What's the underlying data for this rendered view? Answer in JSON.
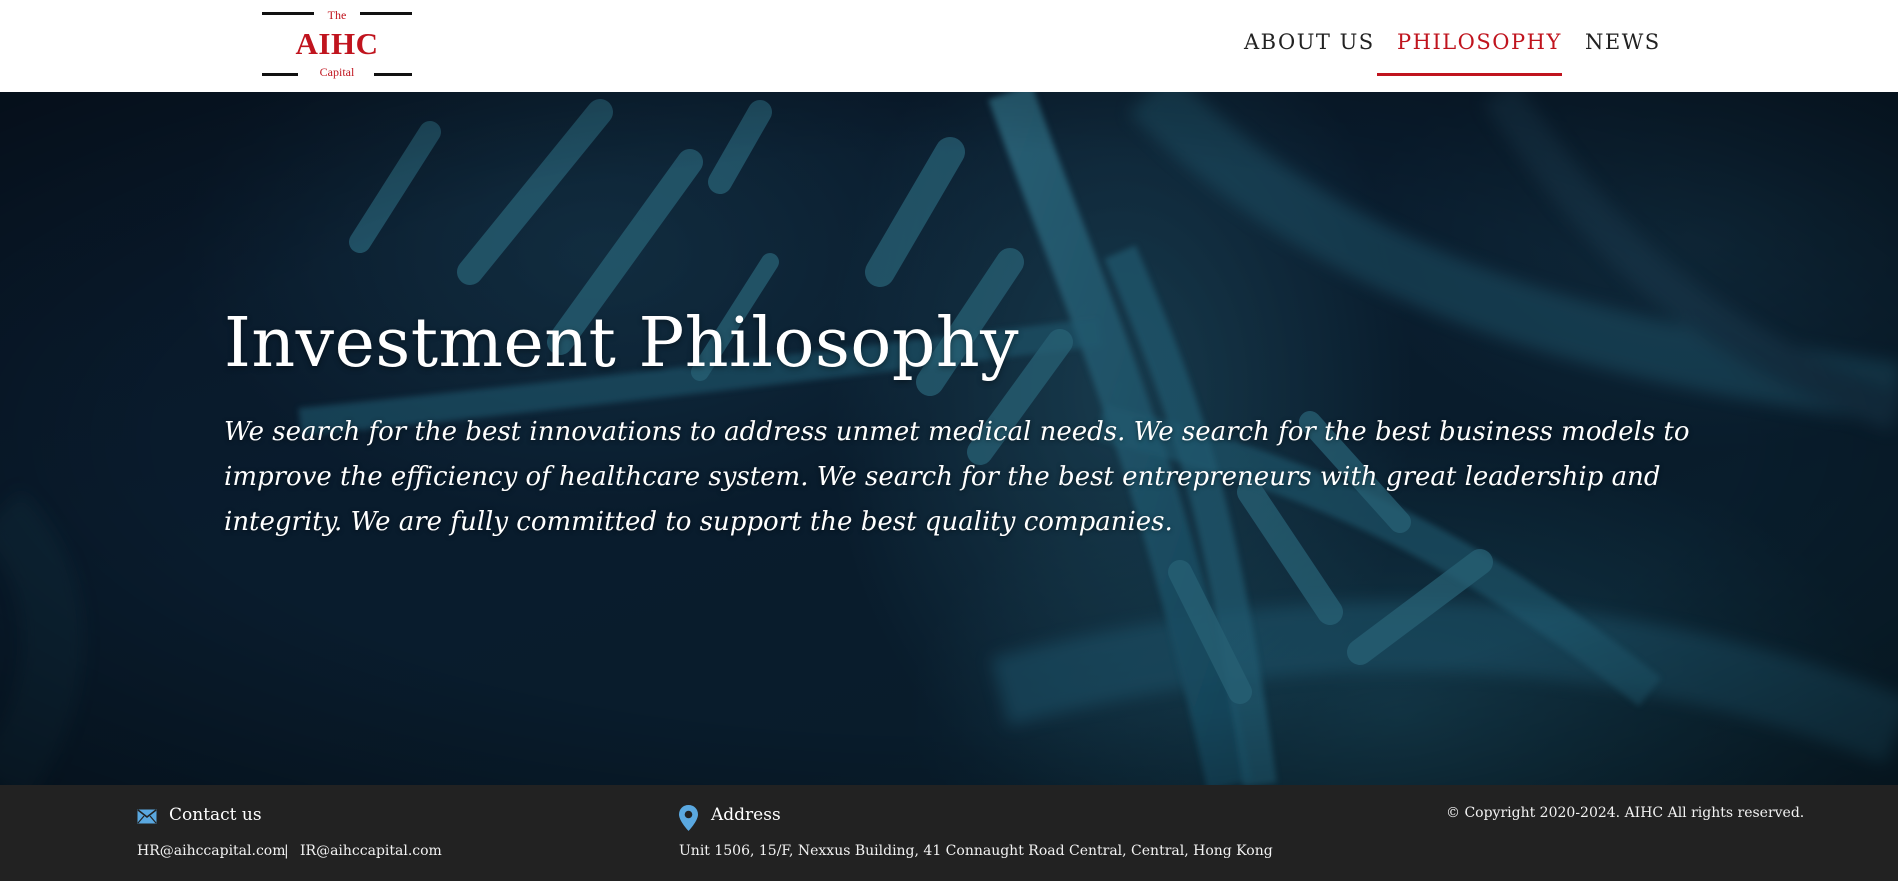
{
  "brand": {
    "the": "The",
    "name": "AIHC",
    "sub": "Capital",
    "color": "#c0141e"
  },
  "nav": {
    "items": [
      {
        "label": "ABOUT US",
        "active": false
      },
      {
        "label": "PHILOSOPHY",
        "active": true
      },
      {
        "label": "NEWS",
        "active": false
      }
    ]
  },
  "hero": {
    "title": "Investment Philosophy",
    "body": "We search for the best innovations to address unmet medical needs. We search for the best business models to improve the efficiency of healthcare system. We search for the best entrepreneurs with great leadership and integrity. We are fully committed to support the best quality companies.",
    "background": "dna-strand-image"
  },
  "footer": {
    "contact": {
      "icon": "envelope-icon",
      "heading": "Contact us",
      "email_hr": "HR@aihccapital.com",
      "separator": "|",
      "email_ir": "IR@aihccapital.com"
    },
    "address": {
      "icon": "map-pin-icon",
      "heading": "Address",
      "text": "Unit 1506, 15/F, Nexxus Building, 41 Connaught Road Central, Central, Hong Kong"
    },
    "copyright": "© Copyright 2020-2024. AIHC All rights reserved.",
    "icon_color": "#5aa8e0"
  }
}
